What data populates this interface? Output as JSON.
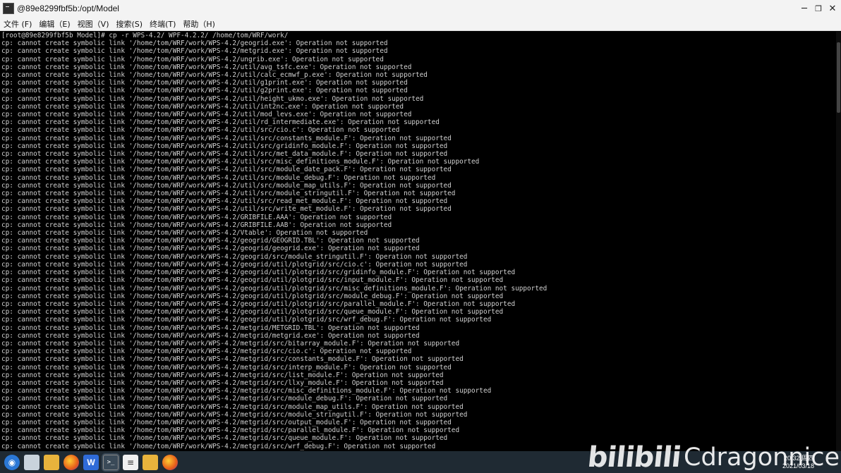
{
  "window": {
    "title": "@89e8299fbf5b:/opt/Model",
    "controls": {
      "minimize": "─",
      "maximize": "❐",
      "close": "✕"
    }
  },
  "menu": [
    "文件 (F)",
    "编辑（E)",
    "视图（V)",
    "搜索(S)",
    "终端(T)",
    "帮助（H)"
  ],
  "terminal": {
    "lines": [
      "[root@89e8299fbf5b Model]# cp -r WPS-4.2/ WPF-4.2.2/ /home/tom/WRF/work/",
      "cp: cannot create symbolic link '/home/tom/WRF/work/WPS-4.2/geogrid.exe': Operation not supported",
      "cp: cannot create symbolic link '/home/tom/WRF/work/WPS-4.2/metgrid.exe': Operation not supported",
      "cp: cannot create symbolic link '/home/tom/WRF/work/WPS-4.2/ungrib.exe': Operation not supported",
      "cp: cannot create symbolic link '/home/tom/WRF/work/WPS-4.2/util/avg_tsfc.exe': Operation not supported",
      "cp: cannot create symbolic link '/home/tom/WRF/work/WPS-4.2/util/calc_ecmwf_p.exe': Operation not supported",
      "cp: cannot create symbolic link '/home/tom/WRF/work/WPS-4.2/util/g1print.exe': Operation not supported",
      "cp: cannot create symbolic link '/home/tom/WRF/work/WPS-4.2/util/g2print.exe': Operation not supported",
      "cp: cannot create symbolic link '/home/tom/WRF/work/WPS-4.2/util/height_ukmo.exe': Operation not supported",
      "cp: cannot create symbolic link '/home/tom/WRF/work/WPS-4.2/util/int2nc.exe': Operation not supported",
      "cp: cannot create symbolic link '/home/tom/WRF/work/WPS-4.2/util/mod_levs.exe': Operation not supported",
      "cp: cannot create symbolic link '/home/tom/WRF/work/WPS-4.2/util/rd_intermediate.exe': Operation not supported",
      "cp: cannot create symbolic link '/home/tom/WRF/work/WPS-4.2/util/src/cio.c': Operation not supported",
      "cp: cannot create symbolic link '/home/tom/WRF/work/WPS-4.2/util/src/constants_module.F': Operation not supported",
      "cp: cannot create symbolic link '/home/tom/WRF/work/WPS-4.2/util/src/gridinfo_module.F': Operation not supported",
      "cp: cannot create symbolic link '/home/tom/WRF/work/WPS-4.2/util/src/met_data_module.F': Operation not supported",
      "cp: cannot create symbolic link '/home/tom/WRF/work/WPS-4.2/util/src/misc_definitions_module.F': Operation not supported",
      "cp: cannot create symbolic link '/home/tom/WRF/work/WPS-4.2/util/src/module_date_pack.F': Operation not supported",
      "cp: cannot create symbolic link '/home/tom/WRF/work/WPS-4.2/util/src/module_debug.F': Operation not supported",
      "cp: cannot create symbolic link '/home/tom/WRF/work/WPS-4.2/util/src/module_map_utils.F': Operation not supported",
      "cp: cannot create symbolic link '/home/tom/WRF/work/WPS-4.2/util/src/module_stringutil.F': Operation not supported",
      "cp: cannot create symbolic link '/home/tom/WRF/work/WPS-4.2/util/src/read_met_module.F': Operation not supported",
      "cp: cannot create symbolic link '/home/tom/WRF/work/WPS-4.2/util/src/write_met_module.F': Operation not supported",
      "cp: cannot create symbolic link '/home/tom/WRF/work/WPS-4.2/GRIBFILE.AAA': Operation not supported",
      "cp: cannot create symbolic link '/home/tom/WRF/work/WPS-4.2/GRIBFILE.AAB': Operation not supported",
      "cp: cannot create symbolic link '/home/tom/WRF/work/WPS-4.2/Vtable': Operation not supported",
      "cp: cannot create symbolic link '/home/tom/WRF/work/WPS-4.2/geogrid/GEOGRID.TBL': Operation not supported",
      "cp: cannot create symbolic link '/home/tom/WRF/work/WPS-4.2/geogrid/geogrid.exe': Operation not supported",
      "cp: cannot create symbolic link '/home/tom/WRF/work/WPS-4.2/geogrid/src/module_stringutil.F': Operation not supported",
      "cp: cannot create symbolic link '/home/tom/WRF/work/WPS-4.2/geogrid/util/plotgrid/src/cio.c': Operation not supported",
      "cp: cannot create symbolic link '/home/tom/WRF/work/WPS-4.2/geogrid/util/plotgrid/src/gridinfo_module.F': Operation not supported",
      "cp: cannot create symbolic link '/home/tom/WRF/work/WPS-4.2/geogrid/util/plotgrid/src/input_module.F': Operation not supported",
      "cp: cannot create symbolic link '/home/tom/WRF/work/WPS-4.2/geogrid/util/plotgrid/src/misc_definitions_module.F': Operation not supported",
      "cp: cannot create symbolic link '/home/tom/WRF/work/WPS-4.2/geogrid/util/plotgrid/src/module_debug.F': Operation not supported",
      "cp: cannot create symbolic link '/home/tom/WRF/work/WPS-4.2/geogrid/util/plotgrid/src/parallel_module.F': Operation not supported",
      "cp: cannot create symbolic link '/home/tom/WRF/work/WPS-4.2/geogrid/util/plotgrid/src/queue_module.F': Operation not supported",
      "cp: cannot create symbolic link '/home/tom/WRF/work/WPS-4.2/geogrid/util/plotgrid/src/wrf_debug.F': Operation not supported",
      "cp: cannot create symbolic link '/home/tom/WRF/work/WPS-4.2/metgrid/METGRID.TBL': Operation not supported",
      "cp: cannot create symbolic link '/home/tom/WRF/work/WPS-4.2/metgrid/metgrid.exe': Operation not supported",
      "cp: cannot create symbolic link '/home/tom/WRF/work/WPS-4.2/metgrid/src/bitarray_module.F': Operation not supported",
      "cp: cannot create symbolic link '/home/tom/WRF/work/WPS-4.2/metgrid/src/cio.c': Operation not supported",
      "cp: cannot create symbolic link '/home/tom/WRF/work/WPS-4.2/metgrid/src/constants_module.F': Operation not supported",
      "cp: cannot create symbolic link '/home/tom/WRF/work/WPS-4.2/metgrid/src/interp_module.F': Operation not supported",
      "cp: cannot create symbolic link '/home/tom/WRF/work/WPS-4.2/metgrid/src/list_module.F': Operation not supported",
      "cp: cannot create symbolic link '/home/tom/WRF/work/WPS-4.2/metgrid/src/llxy_module.F': Operation not supported",
      "cp: cannot create symbolic link '/home/tom/WRF/work/WPS-4.2/metgrid/src/misc_definitions_module.F': Operation not supported",
      "cp: cannot create symbolic link '/home/tom/WRF/work/WPS-4.2/metgrid/src/module_debug.F': Operation not supported",
      "cp: cannot create symbolic link '/home/tom/WRF/work/WPS-4.2/metgrid/src/module_map_utils.F': Operation not supported",
      "cp: cannot create symbolic link '/home/tom/WRF/work/WPS-4.2/metgrid/src/module_stringutil.F': Operation not supported",
      "cp: cannot create symbolic link '/home/tom/WRF/work/WPS-4.2/metgrid/src/output_module.F': Operation not supported",
      "cp: cannot create symbolic link '/home/tom/WRF/work/WPS-4.2/metgrid/src/parallel_module.F': Operation not supported",
      "cp: cannot create symbolic link '/home/tom/WRF/work/WPS-4.2/metgrid/src/queue_module.F': Operation not supported",
      "cp: cannot create symbolic link '/home/tom/WRF/work/WPS-4.2/metgrid/src/wrf_debug.F': Operation not supported"
    ]
  },
  "taskbar": {
    "wps_label": "W",
    "terminal_label": ">_"
  },
  "watermark": {
    "logo": "bilibili",
    "user": "Cdragonnice"
  },
  "tray": {
    "time": "20:32 周四",
    "date": "2021/03/18"
  }
}
